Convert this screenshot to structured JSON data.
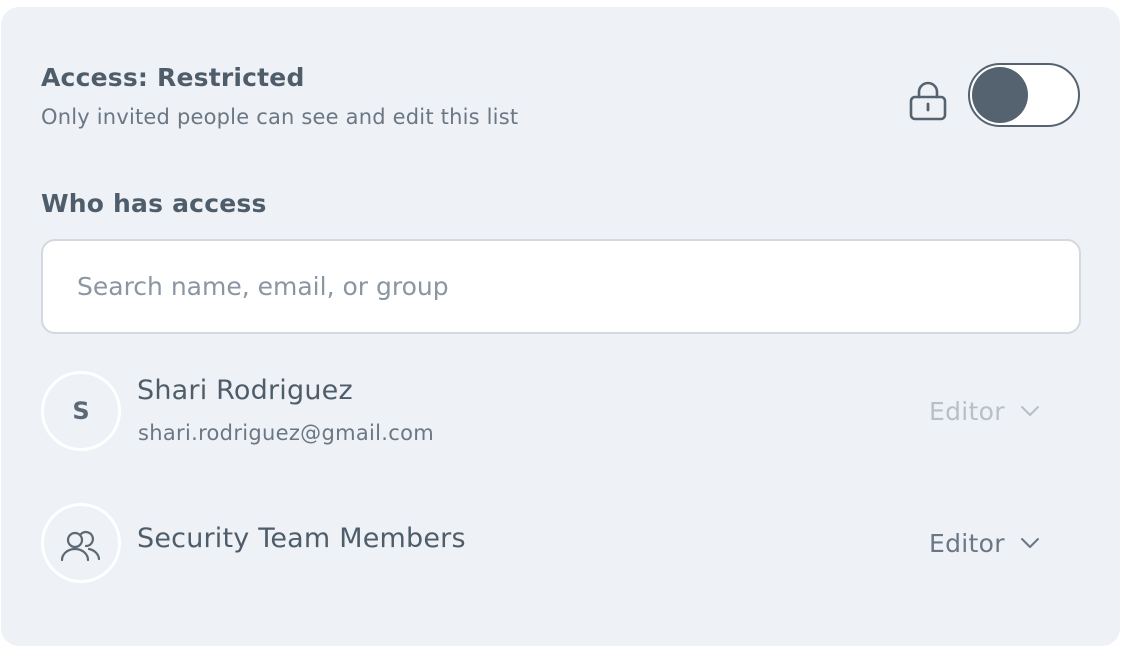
{
  "access": {
    "title": "Access: Restricted",
    "subtitle": "Only invited people can see and edit this list",
    "toggle_on": true
  },
  "who_has_access": {
    "title": "Who has access"
  },
  "search": {
    "placeholder": "Search name, email, or group",
    "value": ""
  },
  "members": [
    {
      "initial": "S",
      "name": "Shari Rodriguez",
      "email": "shari.rodriguez@gmail.com",
      "role": "Editor",
      "role_disabled": true
    },
    {
      "icon": "group-icon",
      "name": "Security Team Members",
      "role": "Editor",
      "role_disabled": false
    }
  ],
  "colors": {
    "panel_bg": "#eef1f5",
    "text_primary": "#4f5d6b",
    "toggle_knob": "#55626f"
  }
}
